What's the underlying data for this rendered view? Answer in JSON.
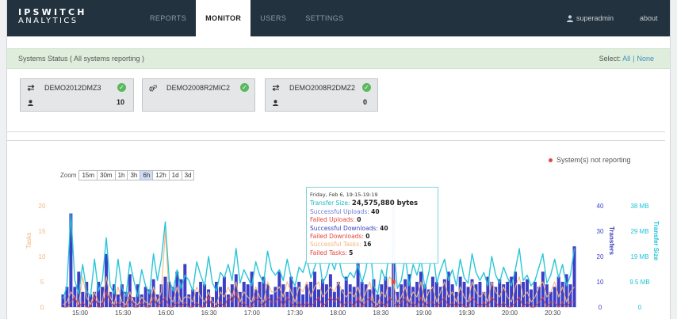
{
  "header": {
    "logo_line1": "IPSWITCH",
    "logo_line2": "ANALYTICS",
    "nav": [
      {
        "label": "REPORTS",
        "active": false
      },
      {
        "label": "MONITOR",
        "active": true
      },
      {
        "label": "USERS",
        "active": false
      },
      {
        "label": "SETTINGS",
        "active": false
      }
    ],
    "user": "superadmin",
    "about": "about"
  },
  "status_bar": {
    "text": "Systems Status ( All systems reporting )",
    "select_label": "Select:",
    "select_all": "All",
    "select_sep": "|",
    "select_none": "None"
  },
  "systems": [
    {
      "name": "DEMO2012DMZ3",
      "icon": "transfer-arrows-icon",
      "count": "10"
    },
    {
      "name": "DEMO2008R2MIC2",
      "icon": "gears-icon",
      "count": ""
    },
    {
      "name": "DEMO2008R2DMZ2",
      "icon": "transfer-arrows-icon",
      "count": "0"
    }
  ],
  "legend": {
    "not_reporting": "System(s) not reporting"
  },
  "zoom": {
    "label": "Zoom",
    "options": [
      "15m",
      "30m",
      "1h",
      "3h",
      "6h",
      "12h",
      "1d",
      "3d"
    ],
    "active": "6h"
  },
  "tooltip": {
    "date": "Friday, Feb 6, 19:15-19:19",
    "transfer_size_label": "Transfer Size:",
    "transfer_size_value": "24,575,880 bytes",
    "successful_uploads_label": "Successful Uploads:",
    "successful_uploads_value": "40",
    "failed_uploads_label": "Failed Uploads:",
    "failed_uploads_value": "0",
    "successful_downloads_label": "Successful Downloads:",
    "successful_downloads_value": "40",
    "failed_downloads_label": "Failed Downloads:",
    "failed_downloads_value": "0",
    "successful_tasks_label": "Successful Tasks:",
    "successful_tasks_value": "16",
    "failed_tasks_label": "Failed Tasks:",
    "failed_tasks_value": "5"
  },
  "colors": {
    "topbar": "#22323f",
    "bars": "#3c3ec6",
    "transfer_size": "#1fc3d6",
    "tasks_ok": "#f2b57c",
    "tasks_fail": "#e2473e",
    "status_green": "#5cb85c"
  },
  "chart_data": {
    "type": "bar",
    "x": [
      "15:00",
      "15:30",
      "16:00",
      "16:30",
      "17:00",
      "17:30",
      "18:00",
      "18:30",
      "19:00",
      "19:30",
      "20:00",
      "20:30"
    ],
    "xlabel": "",
    "axes": [
      {
        "label": "Tasks",
        "side": "left",
        "ticks": [
          "0",
          "5",
          "10",
          "15",
          "20"
        ],
        "range": [
          0,
          20
        ]
      },
      {
        "label": "Transfers",
        "side": "right",
        "ticks": [
          "0",
          "10",
          "20",
          "30",
          "40"
        ],
        "range": [
          0,
          40
        ]
      },
      {
        "label": "Transfer Size",
        "side": "right",
        "ticks": [
          "0",
          "9.5 MB",
          "19 MB",
          "29 MB",
          "38 MB"
        ],
        "range": [
          0,
          38
        ]
      }
    ],
    "series": [
      {
        "type": "bar",
        "axis": "Transfers",
        "values": [
          5,
          8,
          37,
          8,
          14,
          6,
          10,
          5,
          6,
          10,
          8,
          21,
          6,
          9,
          5,
          9,
          6,
          13,
          4,
          9,
          5,
          8,
          7,
          11,
          5,
          9,
          12,
          10,
          8,
          14,
          11,
          17,
          5,
          7,
          6,
          10,
          9,
          7,
          4,
          10,
          8,
          12,
          5,
          9,
          13,
          6,
          10,
          9,
          14,
          7,
          10,
          12,
          9,
          5,
          8,
          14,
          9,
          6,
          12,
          8,
          10,
          5,
          9,
          10,
          14,
          7,
          11,
          9,
          13,
          6,
          10,
          7,
          12,
          9,
          8,
          18,
          10,
          9,
          7,
          11,
          5,
          9,
          12,
          8,
          40,
          6,
          9,
          11,
          13,
          8,
          10,
          14,
          9,
          7,
          12,
          10,
          8,
          11,
          14,
          9,
          6,
          12,
          10,
          8,
          11,
          9,
          10,
          6,
          12,
          10,
          8,
          11,
          9,
          10,
          12,
          14,
          9,
          10,
          11,
          7,
          10,
          8,
          14,
          9,
          6,
          8,
          12,
          10,
          13,
          9,
          24
        ]
      },
      {
        "type": "line",
        "axis": "Transfer Size",
        "values": [
          3,
          8,
          35,
          10,
          5,
          16,
          6,
          4,
          18,
          6,
          10,
          26,
          8,
          5,
          18,
          7,
          4,
          17,
          10,
          4,
          14,
          8,
          5,
          20,
          10,
          18,
          32,
          10,
          6,
          14,
          7,
          12,
          10,
          6,
          17,
          12,
          8,
          19,
          9,
          6,
          13,
          11,
          16,
          10,
          22,
          9,
          14,
          11,
          8,
          17,
          12,
          9,
          21,
          14,
          12,
          14,
          10,
          18,
          11,
          8,
          15,
          13,
          18,
          11,
          15,
          20,
          9,
          12,
          18,
          14,
          19,
          12,
          10,
          13,
          11,
          16,
          9,
          14,
          24,
          8,
          5,
          14,
          10,
          22,
          24,
          7,
          10,
          19,
          8,
          16,
          12,
          18,
          7,
          13,
          22,
          9,
          14,
          18,
          10,
          14,
          8,
          18,
          11,
          9,
          20,
          13,
          10,
          13,
          8,
          19,
          12,
          9,
          15,
          11,
          8,
          14,
          22,
          10,
          12,
          8,
          10,
          15,
          20,
          9,
          12,
          18,
          11,
          16,
          8,
          12,
          22
        ]
      },
      {
        "type": "line",
        "axis": "Tasks",
        "values": [
          0.5,
          1,
          3,
          2,
          0.5,
          6,
          2,
          0.5,
          3,
          1,
          1,
          6,
          2,
          0.5,
          4,
          1,
          0.5,
          3,
          1,
          0.5,
          2,
          1,
          0.5,
          4,
          1,
          3,
          15,
          2,
          1,
          4,
          1,
          2,
          2,
          1,
          4,
          2,
          1,
          3,
          1,
          0.5,
          3,
          2,
          4,
          2,
          5,
          1,
          3,
          2,
          1,
          4,
          2,
          1,
          5,
          3,
          3,
          4,
          2,
          5,
          3,
          1,
          4,
          3,
          5,
          2,
          4,
          5,
          2,
          3,
          4,
          3,
          5,
          3,
          2,
          3,
          2,
          4,
          1,
          3,
          5,
          1,
          0.5,
          3,
          2,
          6,
          5,
          1,
          2,
          4,
          1,
          3,
          2,
          5,
          1,
          3,
          4,
          1,
          3,
          5,
          2,
          3,
          1,
          4,
          2,
          1,
          5,
          3,
          2,
          3,
          1,
          5,
          3,
          2,
          4,
          2,
          1,
          4,
          6,
          2,
          3,
          1,
          2,
          4,
          5,
          2,
          3,
          5,
          2,
          4,
          1,
          3,
          4
        ]
      },
      {
        "type": "line",
        "axis": "Tasks",
        "values": [
          0,
          0,
          1,
          2,
          0,
          1,
          0,
          0,
          2,
          0,
          0,
          3,
          1,
          0,
          1,
          0,
          0,
          2,
          0,
          0,
          1,
          0,
          0,
          2,
          0,
          1,
          2,
          0,
          0,
          1,
          0,
          1,
          0,
          0,
          1,
          0,
          0,
          2,
          0,
          0,
          1,
          0,
          2,
          1,
          3,
          0,
          1,
          0,
          0,
          2,
          1,
          0,
          2,
          1,
          1,
          2,
          0,
          2,
          1,
          0,
          1,
          0,
          1,
          0,
          1,
          2,
          0,
          1,
          2,
          1,
          2,
          0,
          1,
          1,
          0,
          2,
          0,
          1,
          2,
          0,
          0,
          1,
          0,
          2,
          1,
          0,
          1,
          2,
          0,
          1,
          0,
          2,
          0,
          1,
          1,
          0,
          1,
          2,
          0,
          1,
          0,
          1,
          0,
          0,
          2,
          1,
          0,
          1,
          0,
          2,
          1,
          0,
          1,
          0,
          0,
          1,
          2,
          0,
          1,
          0,
          0,
          1,
          2,
          0,
          1,
          1,
          0,
          1,
          0,
          1,
          1
        ]
      }
    ],
    "hover_index": 84
  }
}
